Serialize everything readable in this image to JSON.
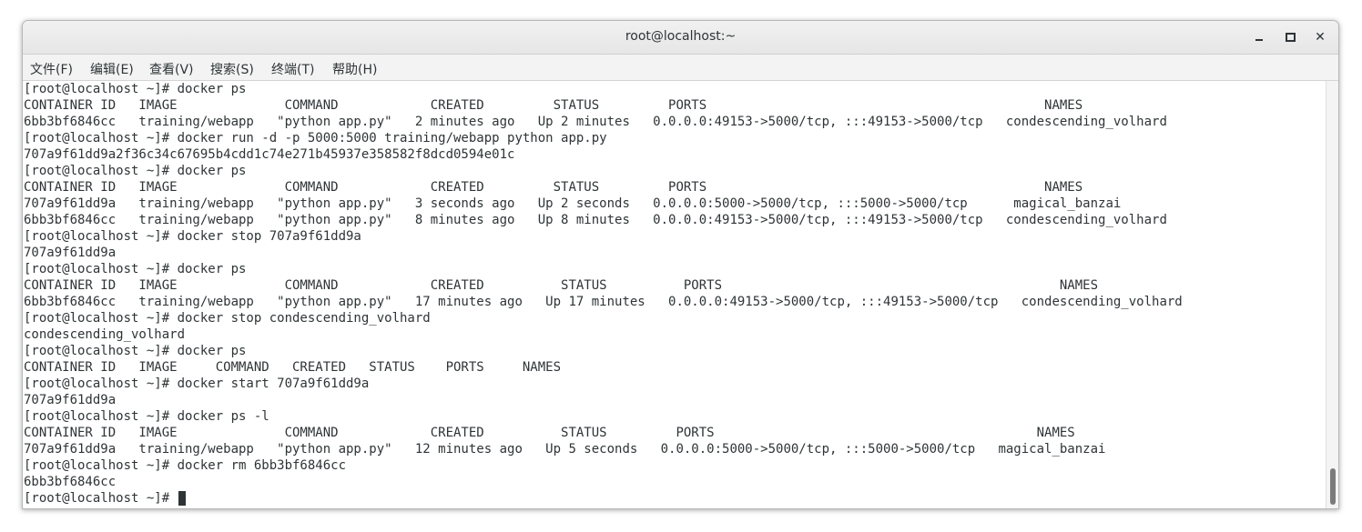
{
  "window": {
    "title": "root@localhost:~",
    "minimize_icon": "minimize-icon",
    "maximize_icon": "maximize-icon",
    "close_label": "✕"
  },
  "menu": {
    "items": [
      "文件(F)",
      "编辑(E)",
      "查看(V)",
      "搜索(S)",
      "终端(T)",
      "帮助(H)"
    ]
  },
  "terminal": {
    "lines": [
      "[root@localhost ~]# docker ps",
      "CONTAINER ID   IMAGE              COMMAND            CREATED         STATUS         PORTS                                            NAMES",
      "6bb3bf6846cc   training/webapp   \"python app.py\"   2 minutes ago   Up 2 minutes   0.0.0.0:49153->5000/tcp, :::49153->5000/tcp   condescending_volhard",
      "[root@localhost ~]# docker run -d -p 5000:5000 training/webapp python app.py",
      "707a9f61dd9a2f36c34c67695b4cdd1c74e271b45937e358582f8dcd0594e01c",
      "[root@localhost ~]# docker ps",
      "CONTAINER ID   IMAGE              COMMAND            CREATED         STATUS         PORTS                                            NAMES",
      "707a9f61dd9a   training/webapp   \"python app.py\"   3 seconds ago   Up 2 seconds   0.0.0.0:5000->5000/tcp, :::5000->5000/tcp      magical_banzai",
      "6bb3bf6846cc   training/webapp   \"python app.py\"   8 minutes ago   Up 8 minutes   0.0.0.0:49153->5000/tcp, :::49153->5000/tcp   condescending_volhard",
      "[root@localhost ~]# docker stop 707a9f61dd9a",
      "707a9f61dd9a",
      "[root@localhost ~]# docker ps",
      "CONTAINER ID   IMAGE              COMMAND            CREATED          STATUS          PORTS                                            NAMES",
      "6bb3bf6846cc   training/webapp   \"python app.py\"   17 minutes ago   Up 17 minutes   0.0.0.0:49153->5000/tcp, :::49153->5000/tcp   condescending_volhard",
      "[root@localhost ~]# docker stop condescending_volhard",
      "condescending_volhard",
      "[root@localhost ~]# docker ps",
      "CONTAINER ID   IMAGE     COMMAND   CREATED   STATUS    PORTS     NAMES",
      "[root@localhost ~]# docker start 707a9f61dd9a",
      "707a9f61dd9a",
      "[root@localhost ~]# docker ps -l",
      "CONTAINER ID   IMAGE              COMMAND            CREATED          STATUS         PORTS                                          NAMES",
      "707a9f61dd9a   training/webapp   \"python app.py\"   12 minutes ago   Up 5 seconds   0.0.0.0:5000->5000/tcp, :::5000->5000/tcp   magical_banzai",
      "[root@localhost ~]# docker rm 6bb3bf6846cc",
      "6bb3bf6846cc",
      "[root@localhost ~]# "
    ]
  }
}
